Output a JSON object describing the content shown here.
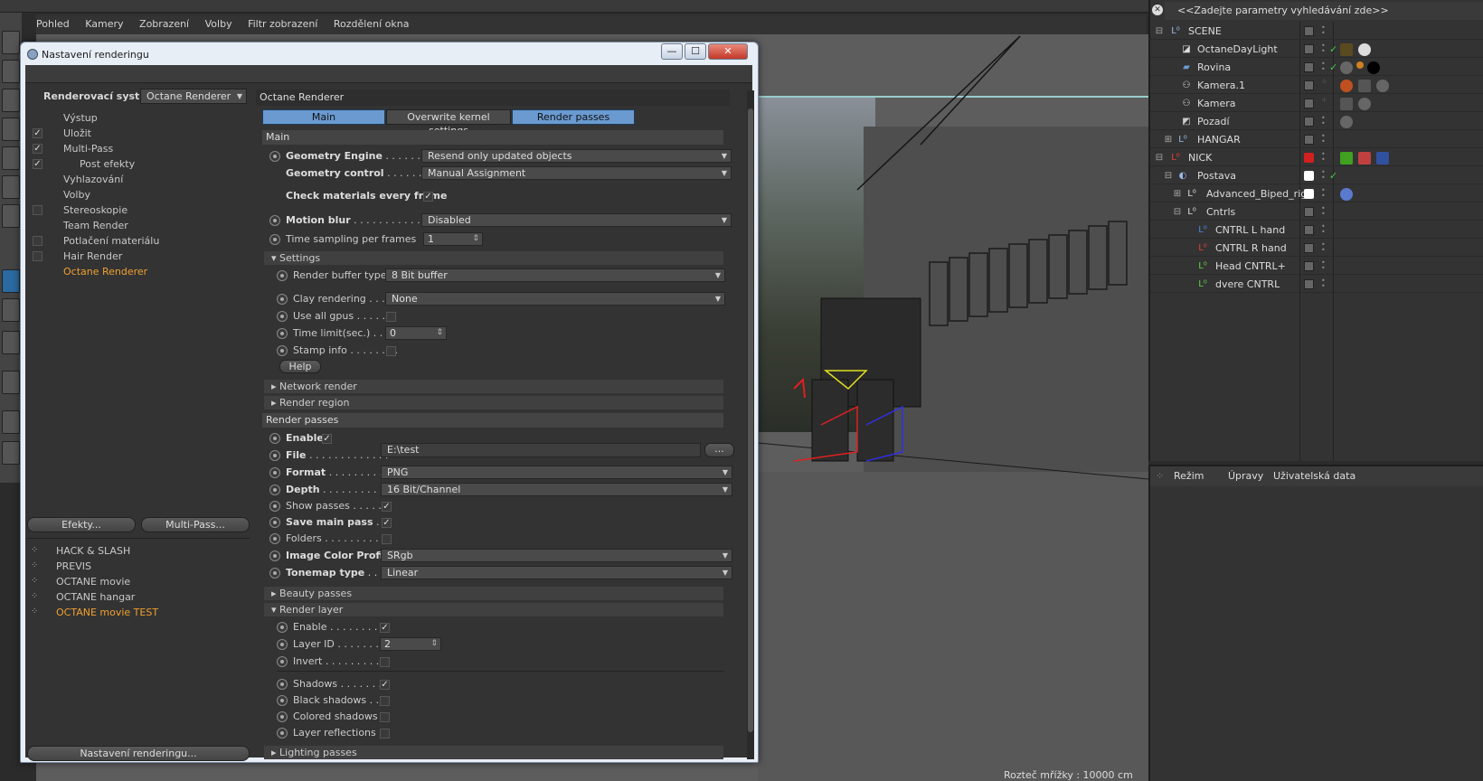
{
  "menubar": {
    "items": [
      "Pohled",
      "Kamery",
      "Zobrazení",
      "Volby",
      "Filtr zobrazení",
      "Rozdělení okna"
    ]
  },
  "viewport": {
    "grid_info": "Rozteč mřížky : 10000 cm"
  },
  "dialog": {
    "title": "Nastavení renderingu",
    "buttons": {
      "minimize": "—",
      "maximize": "☐",
      "close": "✕"
    },
    "left_pane": {
      "renderer_label": "Renderovací systém",
      "renderer_value": "Octane Renderer",
      "items": [
        {
          "label": "Výstup",
          "checked": false,
          "has_checkbox": false
        },
        {
          "label": "Uložit",
          "checked": true,
          "has_checkbox": true
        },
        {
          "label": "Multi-Pass",
          "checked": true,
          "has_checkbox": true
        },
        {
          "label": "Post efekty",
          "checked": true,
          "has_checkbox": true
        },
        {
          "label": "Vyhlazování",
          "checked": false,
          "has_checkbox": false
        },
        {
          "label": "Volby",
          "checked": false,
          "has_checkbox": false
        },
        {
          "label": "Stereoskopie",
          "checked": false,
          "has_checkbox": true
        },
        {
          "label": "Team Render",
          "checked": false,
          "has_checkbox": false
        },
        {
          "label": "Potlačení materiálu",
          "checked": false,
          "has_checkbox": true
        },
        {
          "label": "Hair Render",
          "checked": false,
          "has_checkbox": true
        },
        {
          "label": "Octane Renderer",
          "checked": false,
          "has_checkbox": false
        }
      ],
      "effects_button": "Efekty...",
      "multipass_button": "Multi-Pass...",
      "presets": [
        "HACK & SLASH",
        "PREVIS",
        "OCTANE movie",
        "OCTANE hangar",
        "OCTANE movie TEST"
      ],
      "render_settings_button": "Nastavení renderingu..."
    },
    "right_pane": {
      "header": "Octane Renderer",
      "tabs": [
        "Main",
        "Overwrite kernel settings",
        "Render passes"
      ],
      "main": {
        "section": "Main",
        "geometry_engine_label": "Geometry Engine",
        "geometry_engine_value": "Resend only updated objects",
        "geometry_control_label": "Geometry control",
        "geometry_control_value": "Manual Assignment",
        "check_materials_label": "Check materials every frame",
        "check_materials_checked": true,
        "motion_blur_label": "Motion blur",
        "motion_blur_value": "Disabled",
        "time_sampling_label": "Time sampling per frames",
        "time_sampling_value": "1"
      },
      "settings": {
        "section": "Settings",
        "render_buffer_label": "Render buffer type",
        "render_buffer_value": "8 Bit buffer",
        "clay_label": "Clay rendering",
        "clay_value": "None",
        "all_gpus_label": "Use all gpus",
        "all_gpus_checked": false,
        "time_limit_label": "Time limit(sec.)",
        "time_limit_value": "0",
        "stamp_label": "Stamp info",
        "stamp_checked": false,
        "help_button": "Help"
      },
      "network_render": "Network render",
      "render_region": "Render region",
      "render_passes": {
        "section": "Render passes",
        "enable_label": "Enable",
        "enable_checked": true,
        "file_label": "File",
        "file_value": "E:\\test",
        "file_browse": "...",
        "format_label": "Format",
        "format_value": "PNG",
        "depth_label": "Depth",
        "depth_value": "16 Bit/Channel",
        "show_passes_label": "Show passes",
        "show_passes_checked": true,
        "save_main_label": "Save main pass",
        "save_main_checked": true,
        "folders_label": "Folders",
        "folders_checked": false,
        "color_profile_label": "Image Color Profile",
        "color_profile_value": "SRgb",
        "tonemap_label": "Tonemap type",
        "tonemap_value": "Linear"
      },
      "beauty_passes": "Beauty passes",
      "render_layer": {
        "section": "Render layer",
        "enable_label": "Enable",
        "enable_checked": true,
        "layer_id_label": "Layer ID",
        "layer_id_value": "2",
        "invert_label": "Invert",
        "invert_checked": false,
        "shadows_label": "Shadows",
        "shadows_checked": true,
        "black_shadows_label": "Black shadows",
        "black_shadows_checked": false,
        "colored_shadows_label": "Colored shadows",
        "colored_shadows_checked": false,
        "layer_reflections_label": "Layer reflections",
        "layer_reflections_checked": false
      },
      "lighting_passes": "Lighting passes"
    }
  },
  "object_manager": {
    "search_placeholder": "<<Zadejte parametry vyhledávání zde>>",
    "objects": [
      {
        "name": "SCENE",
        "icon": "null-icon",
        "icon_color": "#9bb8e8"
      },
      {
        "name": "OctaneDayLight",
        "icon": "light-icon",
        "icon_color": "#dddddd"
      },
      {
        "name": "Rovina",
        "icon": "plane-icon",
        "icon_color": "#6a9ad0"
      },
      {
        "name": "Kamera.1",
        "icon": "camera-icon",
        "icon_color": "#dddddd"
      },
      {
        "name": "Kamera",
        "icon": "camera-icon",
        "icon_color": "#dddddd"
      },
      {
        "name": "Pozadí",
        "icon": "background-icon",
        "icon_color": "#cccccc"
      },
      {
        "name": "HANGAR",
        "icon": "null-icon",
        "icon_color": "#9bb8e8"
      },
      {
        "name": "NICK",
        "icon": "null-icon",
        "icon_color": "#e04040"
      },
      {
        "name": "Postava",
        "icon": "character-icon",
        "icon_color": "#9bb8e8"
      },
      {
        "name": "Advanced_Biped_rig",
        "icon": "null-icon",
        "icon_color": "#dddddd"
      },
      {
        "name": "Cntrls",
        "icon": "null-icon",
        "icon_color": "#dddddd"
      },
      {
        "name": "CNTRL L hand",
        "icon": "null-icon",
        "icon_color": "#4a8ae8"
      },
      {
        "name": "CNTRL R hand",
        "icon": "null-icon",
        "icon_color": "#e04040"
      },
      {
        "name": "Head CNTRL+",
        "icon": "null-icon",
        "icon_color": "#60d040"
      },
      {
        "name": "dvere CNTRL",
        "icon": "null-icon",
        "icon_color": "#60d040"
      }
    ]
  },
  "attribute_manager": {
    "menu": [
      "Režim",
      "Úpravy",
      "Uživatelská data"
    ]
  },
  "colors": {
    "accent_orange": "#f0a030",
    "tab_selected": "#6a9ad0"
  }
}
